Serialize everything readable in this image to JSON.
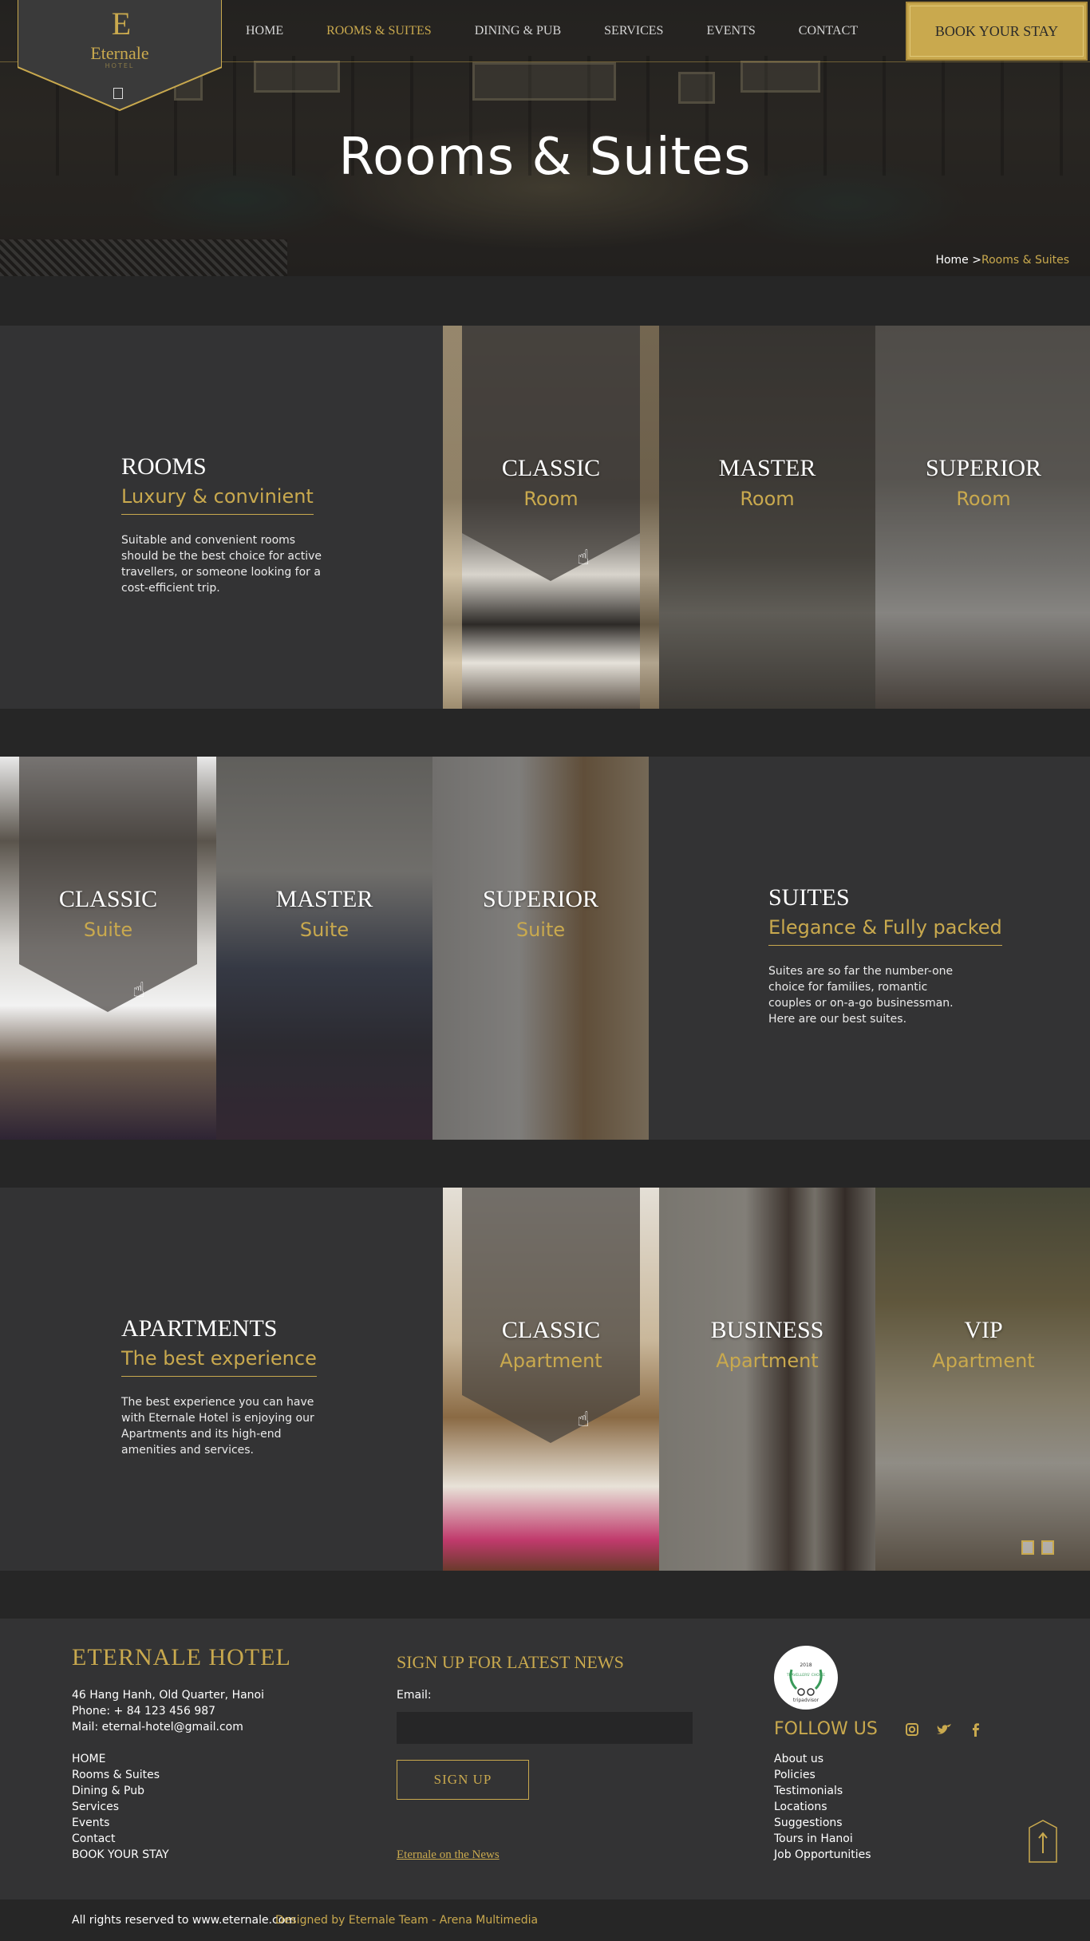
{
  "nav": {
    "logo_text": "Eternale",
    "logo_sub": "HOTEL",
    "items": [
      "HOME",
      "ROOMS & SUITES",
      "DINING & PUB",
      "SERVICES",
      "EVENTS",
      "CONTACT"
    ],
    "active_index": 1,
    "book_label": "BOOK YOUR STAY"
  },
  "hero": {
    "title": "Rooms & Suites",
    "breadcrumb_home": "Home >",
    "breadcrumb_current": "Rooms & Suites"
  },
  "rooms": {
    "title": "ROOMS",
    "subtitle": "Luxury & convinient",
    "description": "Suitable and convenient rooms should be the best choice for active travellers, or someone looking for a cost-efficient trip.",
    "cards": [
      {
        "title": "CLASSIC",
        "sub": "Room"
      },
      {
        "title": "MASTER",
        "sub": "Room"
      },
      {
        "title": "SUPERIOR",
        "sub": "Room"
      }
    ]
  },
  "suites": {
    "title": "SUITES",
    "subtitle": "Elegance & Fully packed",
    "description": "Suites are so far the number-one choice for families, romantic couples or on-a-go businessman. Here are our best suites.",
    "cards": [
      {
        "title": "CLASSIC",
        "sub": "Suite"
      },
      {
        "title": "MASTER",
        "sub": "Suite"
      },
      {
        "title": "SUPERIOR",
        "sub": "Suite"
      }
    ]
  },
  "apartments": {
    "title": "APARTMENTS",
    "subtitle": "The best experience",
    "description": "The best experience you can have with Eternale Hotel is enjoying our Apartments and its high-end amenities and services.",
    "cards": [
      {
        "title": "CLASSIC",
        "sub": "Apartment"
      },
      {
        "title": "BUSINESS",
        "sub": "Apartment"
      },
      {
        "title": "VIP",
        "sub": "Apartment"
      }
    ]
  },
  "footer": {
    "brand": "ETERNALE HOTEL",
    "address": "46 Hang Hanh, Old Quarter, Hanoi",
    "phone": "Phone: + 84 123 456 987",
    "mail": "Mail: eternal-hotel@gmail.com",
    "links": [
      "HOME",
      "Rooms & Suites",
      "Dining & Pub",
      "Services",
      "Events",
      "Contact",
      "BOOK YOUR STAY"
    ],
    "newsletter_title": "SIGN UP FOR LATEST NEWS",
    "email_label": "Email:",
    "email_value": "",
    "signup_label": "SIGN UP",
    "on_news": "Eternale on the News",
    "badge_year": "2018",
    "badge_choice": "TRAVELLERS' CHOICE",
    "badge_brand": "tripadvisor",
    "follow_label": "FOLLOW US",
    "social_icons": [
      "instagram-icon",
      "twitter-icon",
      "facebook-icon"
    ],
    "links2": [
      "About us",
      "Policies",
      "Testimonials",
      "Locations",
      "Suggestions",
      "Tours in Hanoi",
      "Job Opportunities"
    ]
  },
  "copyright": {
    "rights": "All rights reserved to www.eternale.com",
    "designed": "Designed by Eternale Team - Arena Multimedia"
  },
  "colors": {
    "accent": "#c9a94e",
    "dark": "#262626",
    "panel": "#333334"
  }
}
